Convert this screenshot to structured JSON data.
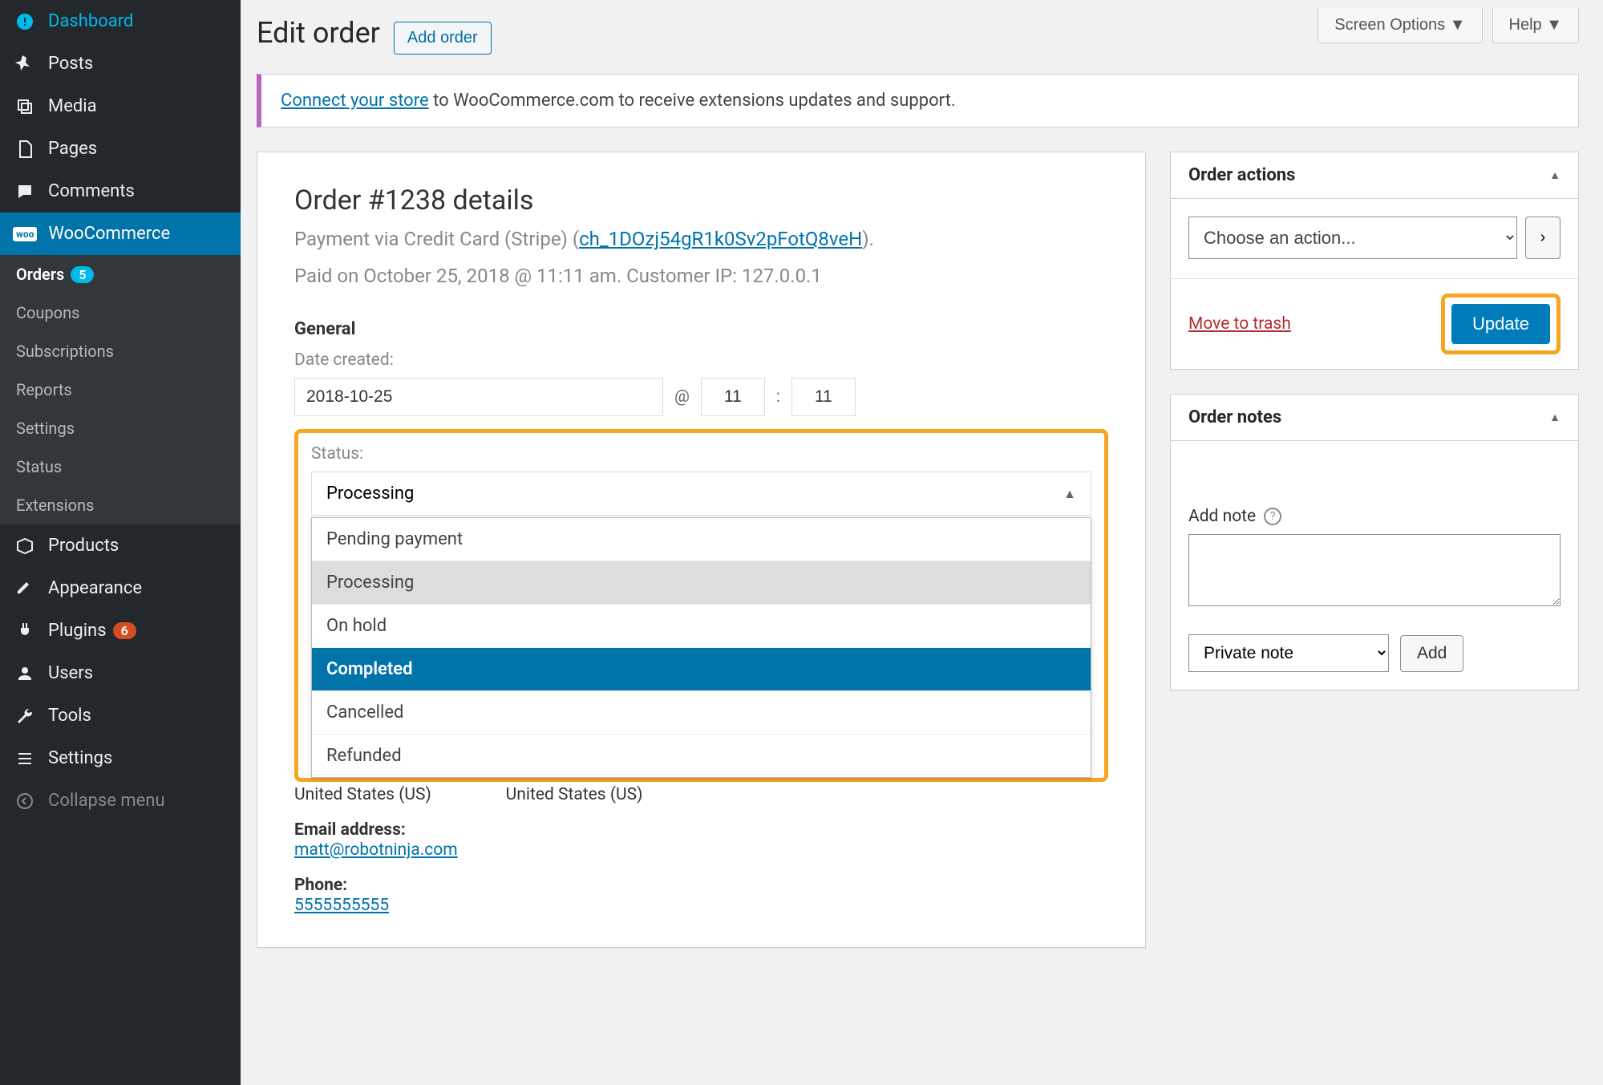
{
  "top": {
    "screen_options": "Screen Options",
    "help": "Help"
  },
  "sidebar": {
    "items": [
      {
        "label": "Dashboard",
        "icon": "dashboard"
      },
      {
        "label": "Posts",
        "icon": "pin"
      },
      {
        "label": "Media",
        "icon": "media"
      },
      {
        "label": "Pages",
        "icon": "page"
      },
      {
        "label": "Comments",
        "icon": "comment"
      },
      {
        "label": "WooCommerce",
        "icon": "woo"
      },
      {
        "label": "Products",
        "icon": "box"
      },
      {
        "label": "Appearance",
        "icon": "brush"
      },
      {
        "label": "Plugins",
        "icon": "plug",
        "badge": "6"
      },
      {
        "label": "Users",
        "icon": "user"
      },
      {
        "label": "Tools",
        "icon": "wrench"
      },
      {
        "label": "Settings",
        "icon": "sliders"
      },
      {
        "label": "Collapse menu",
        "icon": "collapse"
      }
    ],
    "sub": [
      {
        "label": "Orders",
        "badge": "5"
      },
      {
        "label": "Coupons"
      },
      {
        "label": "Subscriptions"
      },
      {
        "label": "Reports"
      },
      {
        "label": "Settings"
      },
      {
        "label": "Status"
      },
      {
        "label": "Extensions"
      }
    ]
  },
  "page": {
    "title": "Edit order",
    "add": "Add order"
  },
  "notice": {
    "link": "Connect your store",
    "rest": " to WooCommerce.com to receive extensions updates and support."
  },
  "order": {
    "title": "Order #1238 details",
    "pay_prefix": "Payment via Credit Card (Stripe) (",
    "pay_link": "ch_1DOzj54gR1k0Sv2pFotQ8veH",
    "pay_suffix": ").",
    "paid_line": "Paid on October 25, 2018 @ 11:11 am. Customer IP: 127.0.0.1",
    "general": "General",
    "date_label": "Date created:",
    "date": "2018-10-25",
    "at": "@",
    "hour": "11",
    "colon": ":",
    "minute": "11",
    "status_label": "Status:",
    "status_value": "Processing",
    "status_options": [
      {
        "label": "Pending payment"
      },
      {
        "label": "Processing",
        "selected": true
      },
      {
        "label": "On hold"
      },
      {
        "label": "Completed",
        "highlighted": true
      },
      {
        "label": "Cancelled"
      },
      {
        "label": "Refunded"
      }
    ],
    "address1": "United States (US)",
    "address2": "United States (US)",
    "email_label": "Email address:",
    "email": "matt@robotninja.com",
    "phone_label": "Phone:",
    "phone": "5555555555"
  },
  "actions": {
    "title": "Order actions",
    "placeholder": "Choose an action...",
    "trash": "Move to trash",
    "update": "Update",
    "go": "›"
  },
  "notes": {
    "title": "Order notes",
    "addlabel": "Add note",
    "type": "Private note",
    "add_btn": "Add"
  }
}
